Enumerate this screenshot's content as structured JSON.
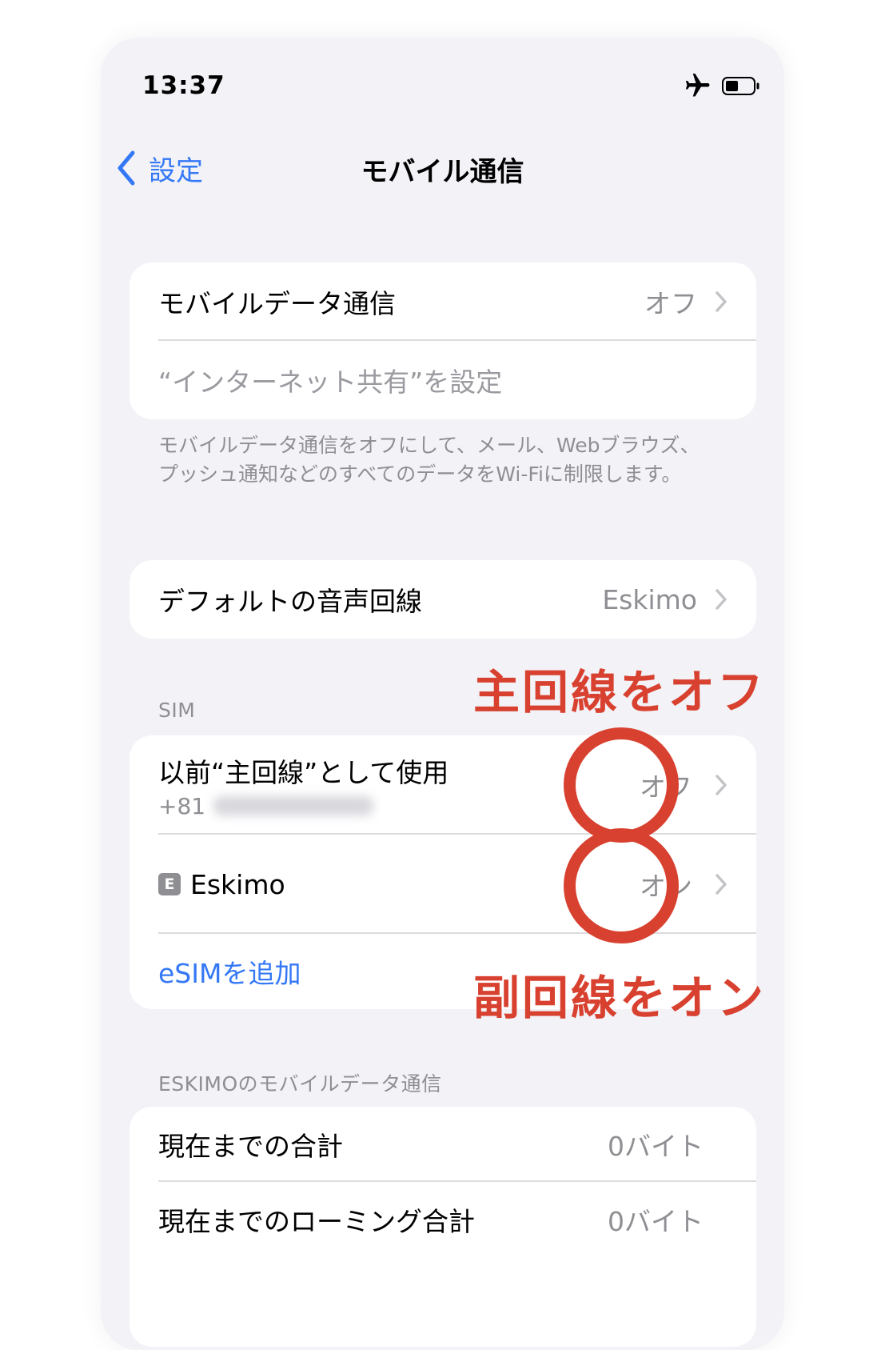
{
  "status_bar": {
    "time": "13:37"
  },
  "nav": {
    "back_label": "設定",
    "title": "モバイル通信"
  },
  "data_group": {
    "mobile_data_label": "モバイルデータ通信",
    "mobile_data_value": "オフ",
    "hotspot_label": "“インターネット共有”を設定"
  },
  "data_footer": "モバイルデータ通信をオフにして、メール、Webブラウズ、プッシュ通知などのすべてのデータをWi-Fiに制限します。",
  "voice_group": {
    "label": "デフォルトの音声回線",
    "value": "Eskimo"
  },
  "sim_header": "SIM",
  "sim_group": {
    "primary_label": "以前“主回線”として使用",
    "primary_number": "+81",
    "primary_value": "オフ",
    "eskimo_badge": "E",
    "eskimo_label": "Eskimo",
    "eskimo_value": "オン",
    "add_esim_label": "eSIMを追加"
  },
  "usage_header": "ESKIMOのモバイルデータ通信",
  "usage_group": {
    "total_label": "現在までの合計",
    "total_value": "0バイト",
    "roaming_label": "現在までのローミング合計",
    "roaming_value": "0バイト"
  },
  "annotations": {
    "primary_off": "主回線をオフ",
    "secondary_on": "副回線をオン"
  },
  "colors": {
    "accent": "#3478f6",
    "annotation": "#d8412f",
    "background": "#f2f2f7"
  }
}
